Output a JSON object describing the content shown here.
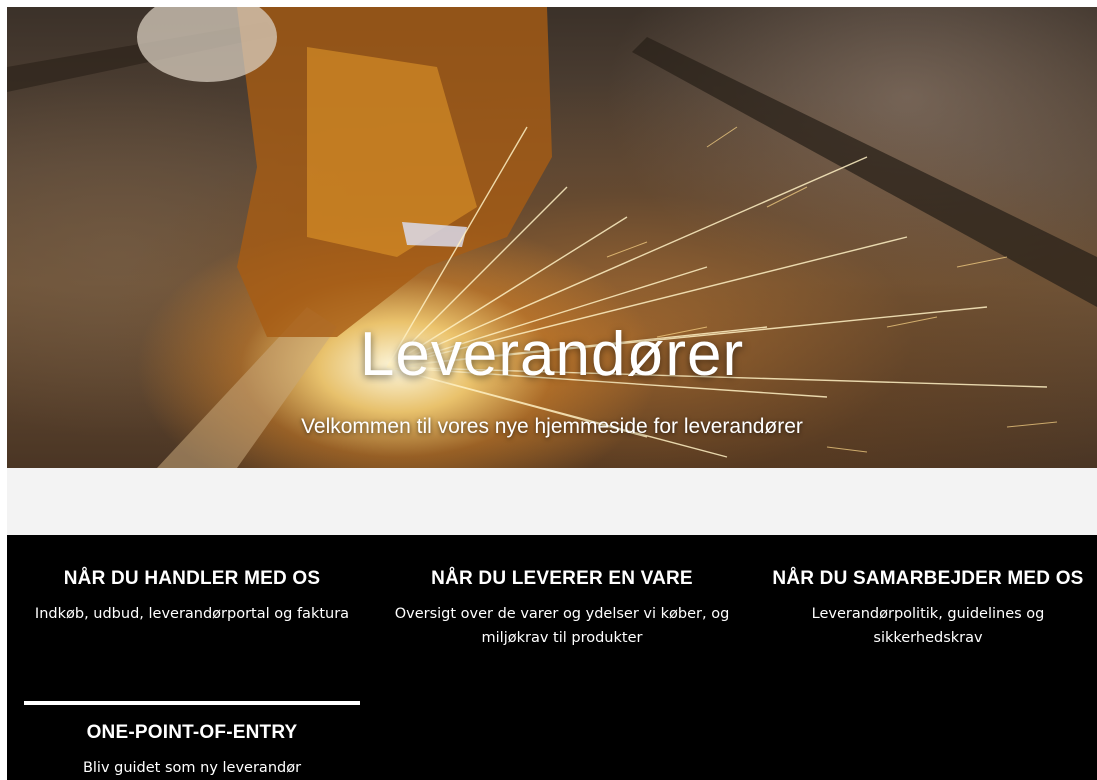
{
  "hero": {
    "title": "Leverandører",
    "subtitle": "Velkommen til vores nye hjemmeside for leverandører"
  },
  "cards": [
    {
      "title": "NÅR DU HANDLER MED OS",
      "text": "Indkøb, udbud, leverandørportal og faktura"
    },
    {
      "title": "NÅR DU LEVERER EN VARE",
      "text": "Oversigt over de varer og ydelser vi køber, og miljøkrav til produkter"
    },
    {
      "title": "NÅR DU SAMARBEJDER MED OS",
      "text": "Leverandørpolitik, guidelines og sikkerhedskrav"
    },
    {
      "title": "ONE-POINT-OF-ENTRY",
      "text": "Bliv guidet som ny leverandør"
    }
  ],
  "colors": {
    "dark_background": "#000000",
    "spacer_background": "#f3f3f3",
    "text": "#ffffff"
  }
}
